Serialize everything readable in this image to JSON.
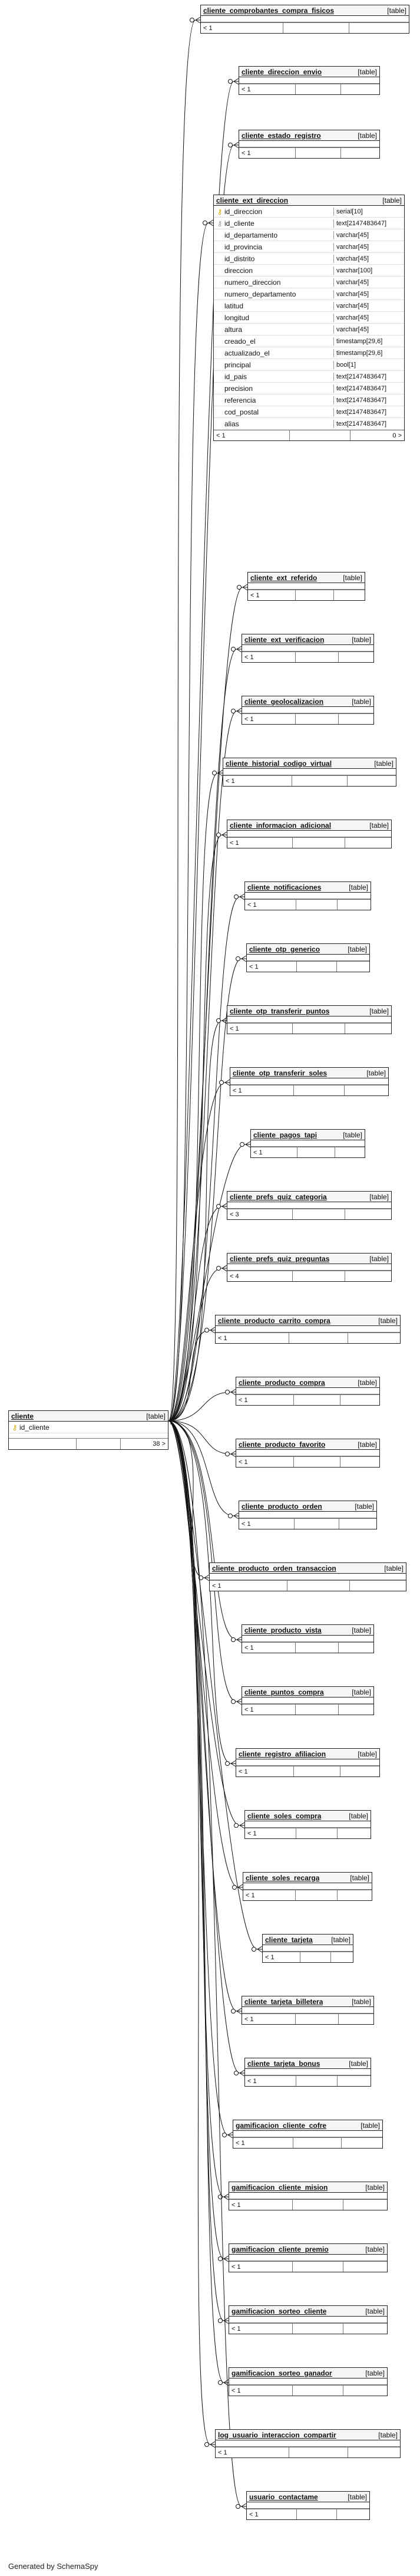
{
  "tables": [
    {
      "id": "t0",
      "name": "cliente_comprobantes_compra_fisicos",
      "kind": "[table]",
      "count": "< 1"
    },
    {
      "id": "t1",
      "name": "cliente_direccion_envio",
      "kind": "[table]",
      "count": "< 1"
    },
    {
      "id": "t2",
      "name": "cliente_estado_registro",
      "kind": "[table]",
      "count": "< 1"
    },
    {
      "id": "t3",
      "name": "cliente_ext_direccion",
      "kind": "[table]",
      "count": "< 1",
      "countRight": "0 >",
      "columns": [
        {
          "name": "id_direccion",
          "type": "serial[10]",
          "key": "pk"
        },
        {
          "name": "id_cliente",
          "type": "text[2147483647]",
          "key": "fk"
        },
        {
          "name": "id_departamento",
          "type": "varchar[45]"
        },
        {
          "name": "id_provincia",
          "type": "varchar[45]"
        },
        {
          "name": "id_distrito",
          "type": "varchar[45]"
        },
        {
          "name": "direccion",
          "type": "varchar[100]"
        },
        {
          "name": "numero_direccion",
          "type": "varchar[45]"
        },
        {
          "name": "numero_departamento",
          "type": "varchar[45]"
        },
        {
          "name": "latitud",
          "type": "varchar[45]"
        },
        {
          "name": "longitud",
          "type": "varchar[45]"
        },
        {
          "name": "altura",
          "type": "varchar[45]"
        },
        {
          "name": "creado_el",
          "type": "timestamp[29,6]"
        },
        {
          "name": "actualizado_el",
          "type": "timestamp[29,6]"
        },
        {
          "name": "principal",
          "type": "bool[1]"
        },
        {
          "name": "id_pais",
          "type": "text[2147483647]"
        },
        {
          "name": "precision",
          "type": "text[2147483647]"
        },
        {
          "name": "referencia",
          "type": "text[2147483647]"
        },
        {
          "name": "cod_postal",
          "type": "text[2147483647]"
        },
        {
          "name": "alias",
          "type": "text[2147483647]"
        }
      ]
    },
    {
      "id": "t4",
      "name": "cliente_ext_referido",
      "kind": "[table]",
      "count": "< 1"
    },
    {
      "id": "t5",
      "name": "cliente_ext_verificacion",
      "kind": "[table]",
      "count": "< 1"
    },
    {
      "id": "t6",
      "name": "cliente_geolocalizacion",
      "kind": "[table]",
      "count": "< 1"
    },
    {
      "id": "t7",
      "name": "cliente_historial_codigo_virtual",
      "kind": "[table]",
      "count": "< 1"
    },
    {
      "id": "t8",
      "name": "cliente_informacion_adicional",
      "kind": "[table]",
      "count": "< 1"
    },
    {
      "id": "t9",
      "name": "cliente_notificaciones",
      "kind": "[table]",
      "count": "< 1"
    },
    {
      "id": "t10",
      "name": "cliente_otp_generico",
      "kind": "[table]",
      "count": "< 1"
    },
    {
      "id": "t11",
      "name": "cliente_otp_transferir_puntos",
      "kind": "[table]",
      "count": "< 1"
    },
    {
      "id": "t12",
      "name": "cliente_otp_transferir_soles",
      "kind": "[table]",
      "count": "< 1"
    },
    {
      "id": "t13",
      "name": "cliente_pagos_tapi",
      "kind": "[table]",
      "count": "< 1"
    },
    {
      "id": "t14",
      "name": "cliente_prefs_quiz_categoria",
      "kind": "[table]",
      "count": "< 3"
    },
    {
      "id": "t15",
      "name": "cliente_prefs_quiz_preguntas",
      "kind": "[table]",
      "count": "< 4"
    },
    {
      "id": "t16",
      "name": "cliente_producto_carrito_compra",
      "kind": "[table]",
      "count": "< 1"
    },
    {
      "id": "t17",
      "name": "cliente_producto_compra",
      "kind": "[table]",
      "count": "< 1"
    },
    {
      "id": "t18",
      "name": "cliente_producto_favorito",
      "kind": "[table]",
      "count": "< 1"
    },
    {
      "id": "t19",
      "name": "cliente_producto_orden",
      "kind": "[table]",
      "count": "< 1"
    },
    {
      "id": "t20",
      "name": "cliente_producto_orden_transaccion",
      "kind": "[table]",
      "count": "< 1"
    },
    {
      "id": "t21",
      "name": "cliente_producto_vista",
      "kind": "[table]",
      "count": "< 1"
    },
    {
      "id": "t22",
      "name": "cliente_puntos_compra",
      "kind": "[table]",
      "count": "< 1"
    },
    {
      "id": "t23",
      "name": "cliente_registro_afiliacion",
      "kind": "[table]",
      "count": "< 1"
    },
    {
      "id": "t24",
      "name": "cliente_soles_compra",
      "kind": "[table]",
      "count": "< 1"
    },
    {
      "id": "t25",
      "name": "cliente_soles_recarga",
      "kind": "[table]",
      "count": "< 1"
    },
    {
      "id": "t26",
      "name": "cliente_tarjeta",
      "kind": "[table]",
      "count": "< 1"
    },
    {
      "id": "t27",
      "name": "cliente_tarjeta_billetera",
      "kind": "[table]",
      "count": "< 1"
    },
    {
      "id": "t28",
      "name": "cliente_tarjeta_bonus",
      "kind": "[table]",
      "count": "< 1"
    },
    {
      "id": "t29",
      "name": "gamificacion_cliente_cofre",
      "kind": "[table]",
      "count": "< 1"
    },
    {
      "id": "t30",
      "name": "gamificacion_cliente_mision",
      "kind": "[table]",
      "count": "< 1"
    },
    {
      "id": "t31",
      "name": "gamificacion_cliente_premio",
      "kind": "[table]",
      "count": "< 1"
    },
    {
      "id": "t32",
      "name": "gamificacion_sorteo_cliente",
      "kind": "[table]",
      "count": "< 1"
    },
    {
      "id": "t33",
      "name": "gamificacion_sorteo_ganador",
      "kind": "[table]",
      "count": "< 1"
    },
    {
      "id": "t34",
      "name": "log_usuario_interaccion_compartir",
      "kind": "[table]",
      "count": "< 1"
    },
    {
      "id": "t35",
      "name": "usuario_contactame",
      "kind": "[table]",
      "count": "< 1"
    }
  ],
  "cliente": {
    "name": "cliente",
    "kind": "[table]",
    "pk_column": "id_cliente",
    "count_right": "38 >"
  },
  "footer": "Generated by SchemaSpy"
}
